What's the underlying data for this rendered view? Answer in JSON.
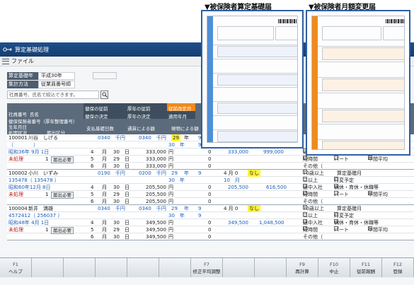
{
  "captions": {
    "left": "▼被保険者算定基礎届",
    "right": "▼被保険者月額変更届"
  },
  "app": {
    "title": "算定基礎処理",
    "menu_file": "ファイル"
  },
  "info": {
    "year_label": "算定基礎年",
    "year_value": "平成30年",
    "method_label": "集計方法",
    "method_value": "従業員番号順"
  },
  "search": {
    "placeholder": "社員番号、氏名で絞込できます。"
  },
  "header": {
    "h1": "社員番号",
    "h2": "氏名",
    "h3": "健保の従前",
    "h4": "厚年の従前",
    "h5": "従前改定月",
    "h6": "健保保険者番号（厚年整理番号）",
    "h7": "健保の決定",
    "h8": "厚年の決定",
    "h9": "適用年月",
    "h10": "生年月日",
    "h11": "支払基礎日数",
    "h12": "通貨による額",
    "h13": "現物による額",
    "h14": "処理状況",
    "h15": "届出区分"
  },
  "records": [
    {
      "id": "100001",
      "name": "川谷　しげる",
      "insurer_no": "（　　　　）",
      "birth": "昭和36年 9月 1日",
      "status": "未処理",
      "report_count": "1",
      "report_btn": "届出必要",
      "prev_health": "0340　千円",
      "prev_pension": "0340　千円",
      "rev_year": "29",
      "rev_year_unit": "年",
      "rev_month": "9",
      "dec_health": "30　年",
      "dec_pension": "9",
      "months": [
        {
          "m": "4",
          "unit": "月",
          "days": "30",
          "d": "日",
          "cash": "333,000",
          "yen1": "円",
          "goods": "0",
          "yen2": "円"
        },
        {
          "m": "5",
          "unit": "月",
          "days": "29",
          "d": "日",
          "cash": "333,000",
          "yen1": "円",
          "goods": "0",
          "yen2": "円"
        },
        {
          "m": "6",
          "unit": "月",
          "days": "30",
          "d": "日",
          "cash": "333,000",
          "yen1": "円",
          "goods": "0",
          "yen2": "円"
        }
      ],
      "total_a": "333,000",
      "total_b": "999,000",
      "avg": "333,000",
      "notes": [
        [
          "70歳以上",
          "病休・育休・休職等"
        ],
        [
          "二以上",
          "月変予定"
        ],
        [
          "途中入社",
          "病休・育休・休職等"
        ],
        [
          "短時間",
          "パート",
          "年間平均"
        ],
        [
          "その他（",
          ""
        ]
      ]
    },
    {
      "id": "100002",
      "name": "小川　いずみ",
      "insurer_no": "135478（ 135478 ）",
      "birth": "昭和60年12月 8日",
      "status": "未処理",
      "report_count": "1",
      "report_btn": "届出必要",
      "prev_health": "0190　千円",
      "prev_pension": "0200　千円",
      "rev_year": "29",
      "rev_year_unit": "年",
      "rev_month": "9",
      "extra": "4 月 0",
      "extra2": "なし",
      "dec_health": "30　年",
      "dec_pension": "10　月",
      "months": [
        {
          "m": "4",
          "unit": "月",
          "days": "30",
          "d": "日",
          "cash": "205,500",
          "yen1": "円",
          "goods": "0",
          "yen2": "円"
        },
        {
          "m": "5",
          "unit": "月",
          "days": "29",
          "d": "日",
          "cash": "205,500",
          "yen1": "円",
          "goods": "0",
          "yen2": "円"
        },
        {
          "m": "6",
          "unit": "月",
          "days": "30",
          "d": "日",
          "cash": "205,500",
          "yen1": "円",
          "goods": "0",
          "yen2": "円"
        }
      ],
      "total_a": "205,500",
      "total_b": "616,500",
      "avg": "205,500"
    },
    {
      "id": "100004",
      "name": "新井　満雄",
      "insurer_no": "4572412（ 256037 ）",
      "birth": "昭和48年 4月 1日",
      "status": "未処理",
      "report_count": "1",
      "report_btn": "届出必要",
      "prev_health": "0340　千円",
      "prev_pension": "0340　千円",
      "rev_year": "29",
      "rev_year_unit": "年",
      "rev_month": "9",
      "extra": "4 月 0",
      "extra2": "なし",
      "dec_health": "30　年",
      "dec_pension": "9",
      "months": [
        {
          "m": "4",
          "unit": "月",
          "days": "30",
          "d": "日",
          "cash": "349,500",
          "yen1": "円",
          "goods": "0",
          "yen2": "円"
        },
        {
          "m": "5",
          "unit": "月",
          "days": "29",
          "d": "日",
          "cash": "349,500",
          "yen1": "円",
          "goods": "0",
          "yen2": "円"
        },
        {
          "m": "6",
          "unit": "月",
          "days": "30",
          "d": "日",
          "cash": "349,500",
          "yen1": "円",
          "goods": "0",
          "yen2": "円"
        }
      ],
      "total_a": "349,500",
      "total_b": "1,048,500",
      "avg": "349,500"
    }
  ],
  "note_labels": {
    "n1": "途中入社",
    "n2": "病休・育休・休職等",
    "n3": "短時間",
    "n4": "パート",
    "n5": "年間平均",
    "n6": "その他（",
    "n7": "70歳以上",
    "n8": "算定基礎月",
    "n9": "月",
    "n10": "二以上",
    "n11": "月変予定"
  },
  "fkeys": [
    {
      "key": "F1",
      "label": "ヘルプ"
    },
    {
      "key": "",
      "label": ""
    },
    {
      "key": "",
      "label": ""
    },
    {
      "key": "",
      "label": ""
    },
    {
      "key": "",
      "label": ""
    },
    {
      "key": "",
      "label": ""
    },
    {
      "key": "F7",
      "label": "修正平均調整"
    },
    {
      "key": "",
      "label": ""
    },
    {
      "key": "",
      "label": ""
    },
    {
      "key": "F9",
      "label": "再計算"
    },
    {
      "key": "F10",
      "label": "中止"
    },
    {
      "key": "F11",
      "label": "従前報酬"
    },
    {
      "key": "F12",
      "label": "登録"
    }
  ]
}
